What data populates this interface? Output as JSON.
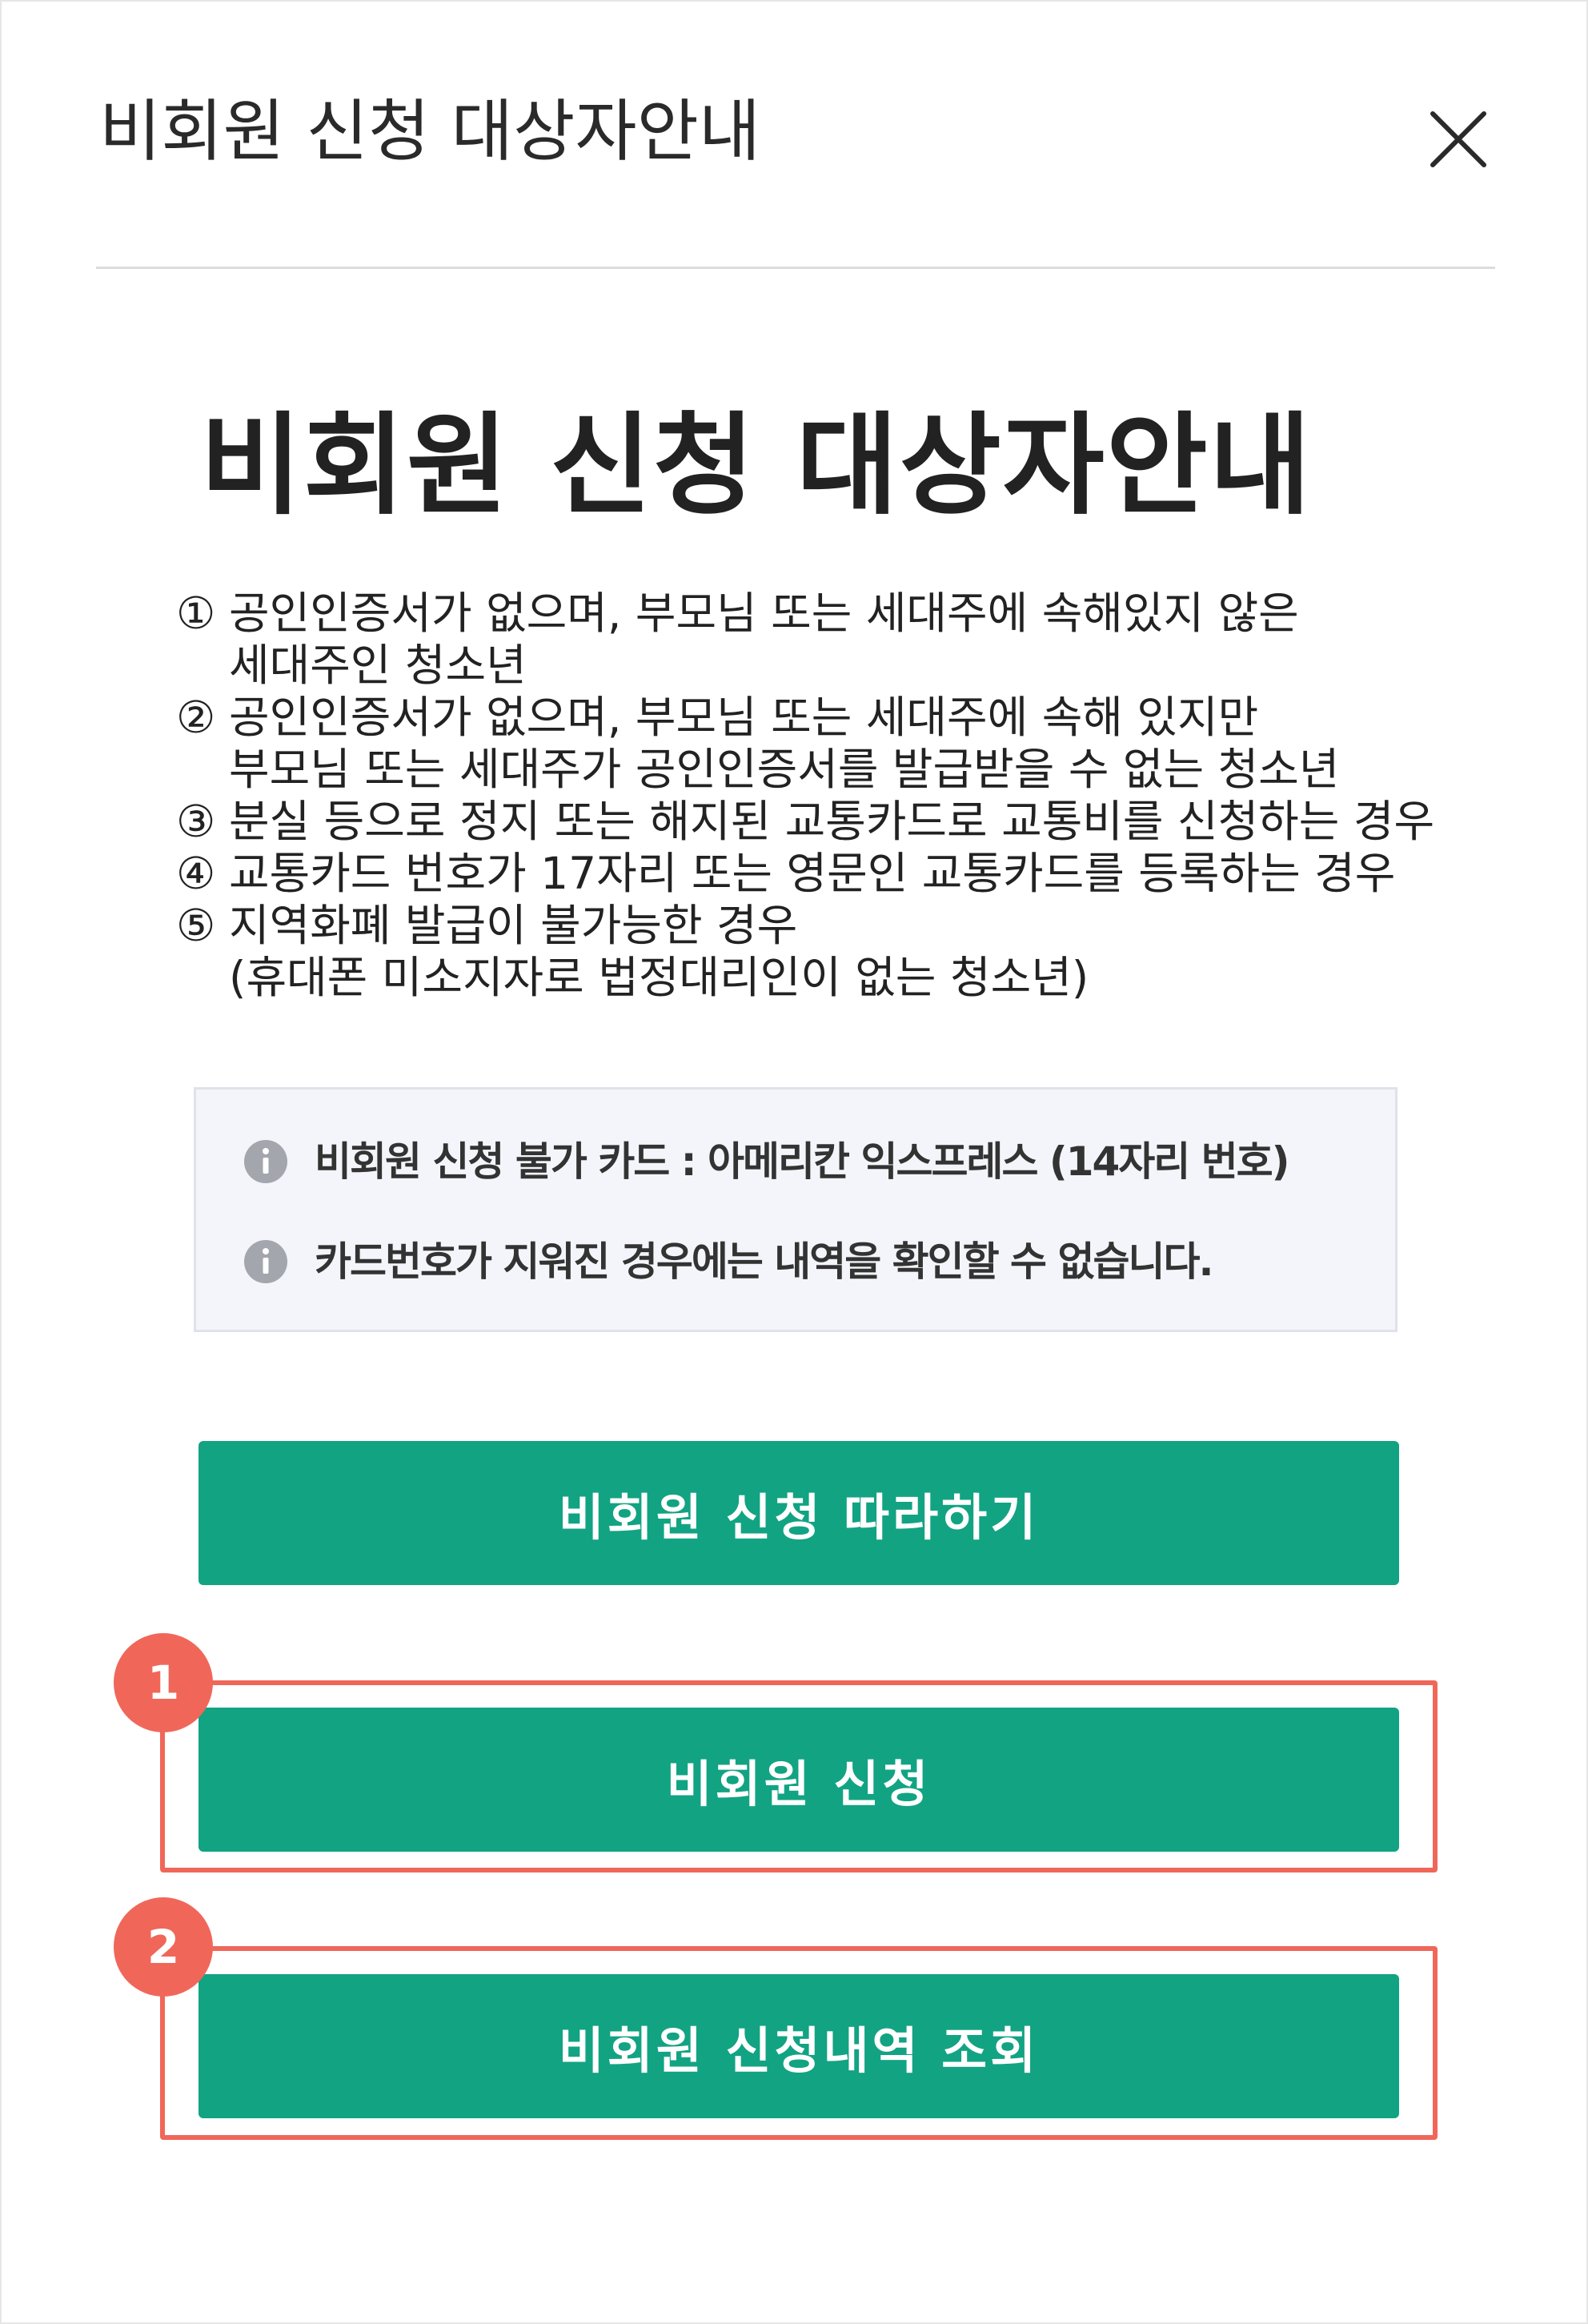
{
  "header": {
    "title": "비회원 신청 대상자안내",
    "close_icon": "close-icon"
  },
  "main": {
    "title": "비회원 신청 대상자안내",
    "items": [
      {
        "num": "①",
        "lines": [
          "공인인증서가 없으며, 부모님 또는 세대주에 속해있지 않은",
          "세대주인 청소년"
        ]
      },
      {
        "num": "②",
        "lines": [
          "공인인증서가 없으며, 부모님 또는 세대주에 속해 있지만",
          "부모님 또는 세대주가 공인인증서를 발급받을 수 없는 청소년"
        ]
      },
      {
        "num": "③",
        "lines": [
          "분실 등으로 정지 또는 해지된 교통카드로 교통비를 신청하는 경우"
        ]
      },
      {
        "num": "④",
        "lines": [
          "교통카드 번호가 17자리 또는 영문인 교통카드를 등록하는 경우"
        ]
      },
      {
        "num": "⑤",
        "lines": [
          "지역화폐 발급이 불가능한 경우",
          "(휴대폰 미소지자로 법정대리인이 없는 청소년)"
        ]
      }
    ]
  },
  "notice": {
    "icon": "info-icon",
    "items": [
      "비회원 신청 불가 카드 : 아메리칸 익스프레스 (14자리 번호)",
      "카드번호가 지워진 경우에는 내역을 확인할 수 없습니다."
    ]
  },
  "buttons": {
    "guide": "비회원 신청 따라하기",
    "apply": "비회원 신청",
    "history": "비회원 신청내역 조회"
  },
  "badges": [
    "1",
    "2"
  ],
  "colors": {
    "button_green": "#12a383",
    "highlight_red": "#f0675a",
    "notice_bg": "#f4f5fa"
  }
}
